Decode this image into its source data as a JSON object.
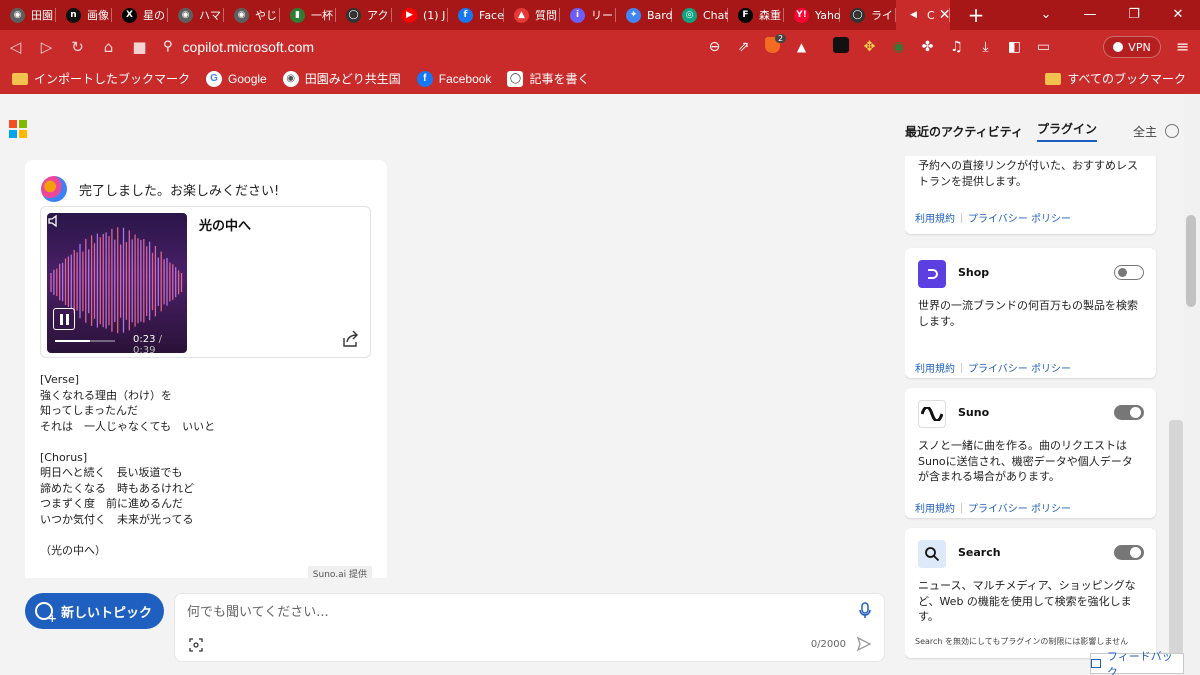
{
  "tabs": [
    {
      "label": "田園",
      "color": "#5f5f5f",
      "glyph": "◉"
    },
    {
      "label": "画像",
      "color": "#111111",
      "glyph": "n"
    },
    {
      "label": "星の",
      "color": "#000000",
      "glyph": "X"
    },
    {
      "label": "ハマ",
      "color": "#5f5f5f",
      "glyph": "◉"
    },
    {
      "label": "やじ",
      "color": "#5f5f5f",
      "glyph": "◉"
    },
    {
      "label": "一杯",
      "color": "#2e7d32",
      "glyph": "▮"
    },
    {
      "label": "アク",
      "color": "#333333",
      "glyph": "◯"
    },
    {
      "label": "(1) J",
      "color": "#ff0000",
      "glyph": "▶"
    },
    {
      "label": "Face",
      "color": "#1877f2",
      "glyph": "f"
    },
    {
      "label": "質問",
      "color": "#e53935",
      "glyph": "▲"
    },
    {
      "label": "リード",
      "color": "#6d5dfc",
      "glyph": "i"
    },
    {
      "label": "Bard",
      "color": "#4285f4",
      "glyph": "✦"
    },
    {
      "label": "Chat",
      "color": "#10a37f",
      "glyph": "◎"
    },
    {
      "label": "森重",
      "color": "#000000",
      "glyph": "F"
    },
    {
      "label": "Yaho",
      "color": "#ff0033",
      "glyph": "Y!"
    },
    {
      "label": "ライ",
      "color": "#333333",
      "glyph": "◯"
    },
    {
      "label": "C",
      "color": "#c92a2a",
      "glyph": "◀"
    }
  ],
  "browser": {
    "url": "copilot.microsoft.com",
    "vpn_label": "VPN",
    "brave_badge": "2"
  },
  "bookmarks": {
    "items": [
      {
        "label": "インポートしたブックマーク",
        "icon": "folder-icon"
      },
      {
        "label": "Google",
        "icon": "google-icon"
      },
      {
        "label": "田園みどり共生国",
        "icon": "globe-icon"
      },
      {
        "label": "Facebook",
        "icon": "facebook-icon"
      },
      {
        "label": "記事を書く",
        "icon": "note-icon"
      }
    ],
    "all_bookmarks": "すべてのブックマーク"
  },
  "header": {
    "nav": [
      "最近のアクティビティ",
      "プラグイン"
    ],
    "active_nav": "プラグイン",
    "extra": "全主"
  },
  "chat": {
    "message": "完了しました。お楽しみください!",
    "song": {
      "title": "光の中へ",
      "current_time": "0:23",
      "duration": "/ 0:39",
      "progress": 0.59
    },
    "lyrics": [
      "[Verse]",
      "強くなれる理由（わけ）を",
      "知ってしまったんだ",
      "それは　一人じゃなくても　いいと",
      "",
      "[Chorus]",
      "明日へと続く　長い坂道でも",
      "諦めたくなる　時もあるけれど",
      "つまずく度　前に進めるんだ",
      "いつか気付く　未来が光ってる",
      "",
      "（光の中へ）"
    ],
    "provider": "Suno.ai 提供"
  },
  "composer": {
    "new_topic": "新しいトピック",
    "placeholder": "何でも聞いてください...",
    "counter": "0/2000"
  },
  "plugins": {
    "partial": {
      "desc": "予約への直接リンクが付いた、おすすめレストランを提供します。",
      "terms": "利用規約",
      "privacy": "プライバシー ポリシー"
    },
    "cards": [
      {
        "name": "Shop",
        "enabled": false,
        "desc": "世界の一流ブランドの何百万もの製品を検索します。",
        "terms": "利用規約",
        "privacy": "プライバシー ポリシー"
      },
      {
        "name": "Suno",
        "enabled": true,
        "desc": "スノと一緒に曲を作る。曲のリクエストはSunoに送信され、機密データや個人データが含まれる場合があります。",
        "terms": "利用規約",
        "privacy": "プライバシー ポリシー"
      },
      {
        "name": "Search",
        "enabled": true,
        "desc": "ニュース、マルチメディア、ショッピングなど、Web の機能を使用して検索を強化します。",
        "note": "Search を無効にしてもプラグインの制限には影響しません"
      }
    ]
  },
  "feedback": "フィードバック"
}
